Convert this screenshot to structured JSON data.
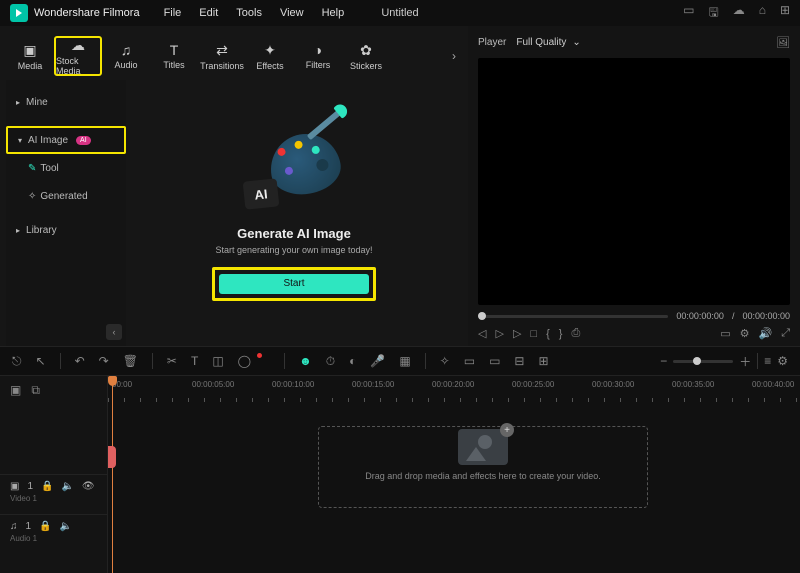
{
  "app": {
    "name": "Wondershare Filmora",
    "project": "Untitled"
  },
  "menu": [
    "File",
    "Edit",
    "Tools",
    "View",
    "Help"
  ],
  "tabs": [
    {
      "label": "Media",
      "icon": "▣"
    },
    {
      "label": "Stock Media",
      "icon": "☁"
    },
    {
      "label": "Audio",
      "icon": "♫"
    },
    {
      "label": "Titles",
      "icon": "T"
    },
    {
      "label": "Transitions",
      "icon": "⇄"
    },
    {
      "label": "Effects",
      "icon": "✦"
    },
    {
      "label": "Filters",
      "icon": "◑"
    },
    {
      "label": "Stickers",
      "icon": "✿"
    }
  ],
  "sidebar": {
    "mine": "Mine",
    "ai_image": "AI Image",
    "ai_badge": "AI",
    "tool": "Tool",
    "generated": "Generated",
    "library": "Library"
  },
  "content": {
    "title": "Generate AI Image",
    "subtitle": "Start generating your own image today!",
    "start": "Start",
    "ai_card": "AI"
  },
  "preview": {
    "player": "Player",
    "quality": "Full Quality",
    "time_current": "00:00:00:00",
    "time_total": "00:00:00:00",
    "sep": "/"
  },
  "timeline": {
    "marks": [
      "00:00",
      "00:00:05:00",
      "00:00:10:00",
      "00:00:15:00",
      "00:00:20:00",
      "00:00:25:00",
      "00:00:30:00",
      "00:00:35:00",
      "00:00:40:00"
    ],
    "drop_text": "Drag and drop media and effects here to create your video.",
    "video_track": {
      "icon": "▣",
      "idx": "1",
      "label": "Video 1"
    },
    "audio_track": {
      "icon": "♫",
      "idx": "1",
      "label": "Audio 1"
    }
  }
}
